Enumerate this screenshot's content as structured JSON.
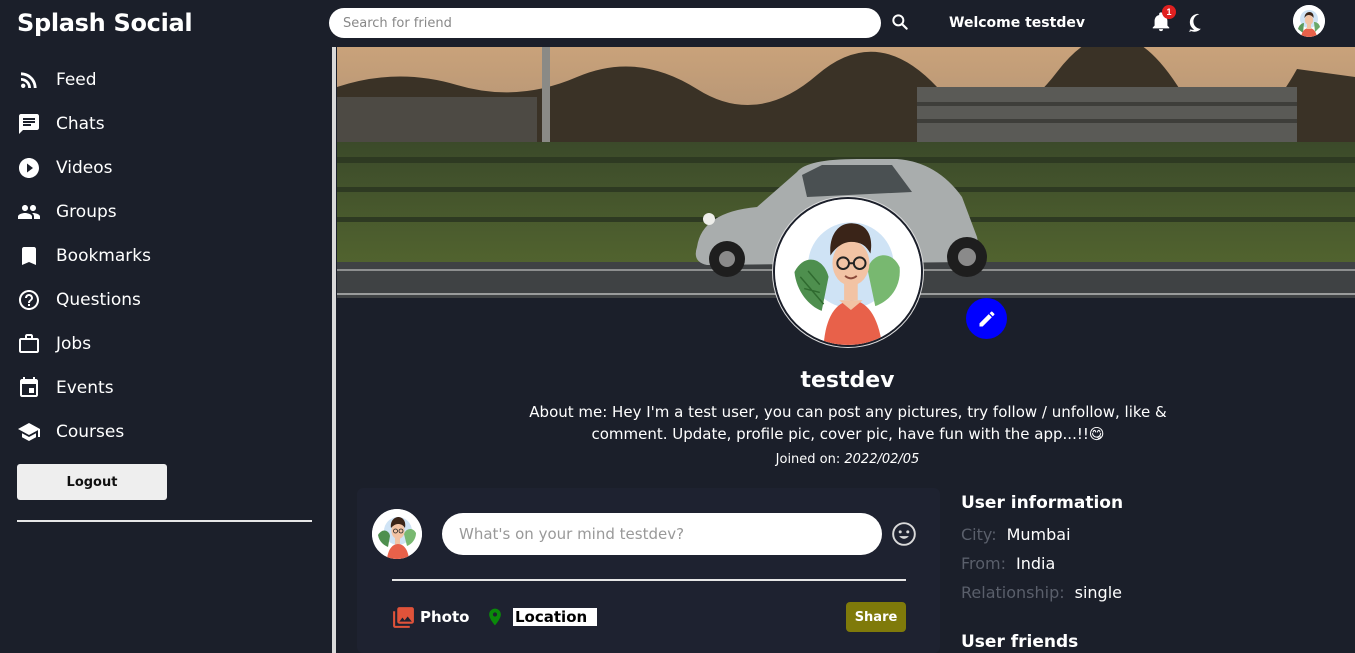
{
  "header": {
    "brand": "Splash Social",
    "search_placeholder": "Search for friend",
    "welcome": "Welcome testdev",
    "notification_count": "1"
  },
  "sidebar": {
    "items": [
      {
        "label": "Feed",
        "icon": "rss-icon"
      },
      {
        "label": "Chats",
        "icon": "chat-icon"
      },
      {
        "label": "Videos",
        "icon": "play-circle-icon"
      },
      {
        "label": "Groups",
        "icon": "group-icon"
      },
      {
        "label": "Bookmarks",
        "icon": "bookmark-icon"
      },
      {
        "label": "Questions",
        "icon": "help-circle-icon"
      },
      {
        "label": "Jobs",
        "icon": "briefcase-icon"
      },
      {
        "label": "Events",
        "icon": "calendar-icon"
      },
      {
        "label": "Courses",
        "icon": "school-icon"
      }
    ],
    "logout_label": "Logout"
  },
  "profile": {
    "username": "testdev",
    "about": "About me: Hey I'm a test user, you can post any pictures, try follow / unfollow, like & comment. Update, profile pic, cover pic, have fun with the app...!!😋",
    "joined_label": "Joined on: ",
    "joined_date": "2022/02/05"
  },
  "share": {
    "placeholder": "What's on your mind testdev?",
    "photo_label": "Photo",
    "location_label": "Location",
    "share_label": "Share"
  },
  "user_info": {
    "title": "User information",
    "city_label": "City:",
    "city": "Mumbai",
    "from_label": "From:",
    "from": "India",
    "relationship_label": "Relationship:",
    "relationship": "single",
    "friends_title": "User friends"
  },
  "colors": {
    "background": "#1b1f2a",
    "edit_button": "#0000ff",
    "share_button": "#7f7a0a",
    "photo_icon": "#e0533a",
    "location_icon": "#0a8a0a",
    "badge": "#e02020"
  }
}
